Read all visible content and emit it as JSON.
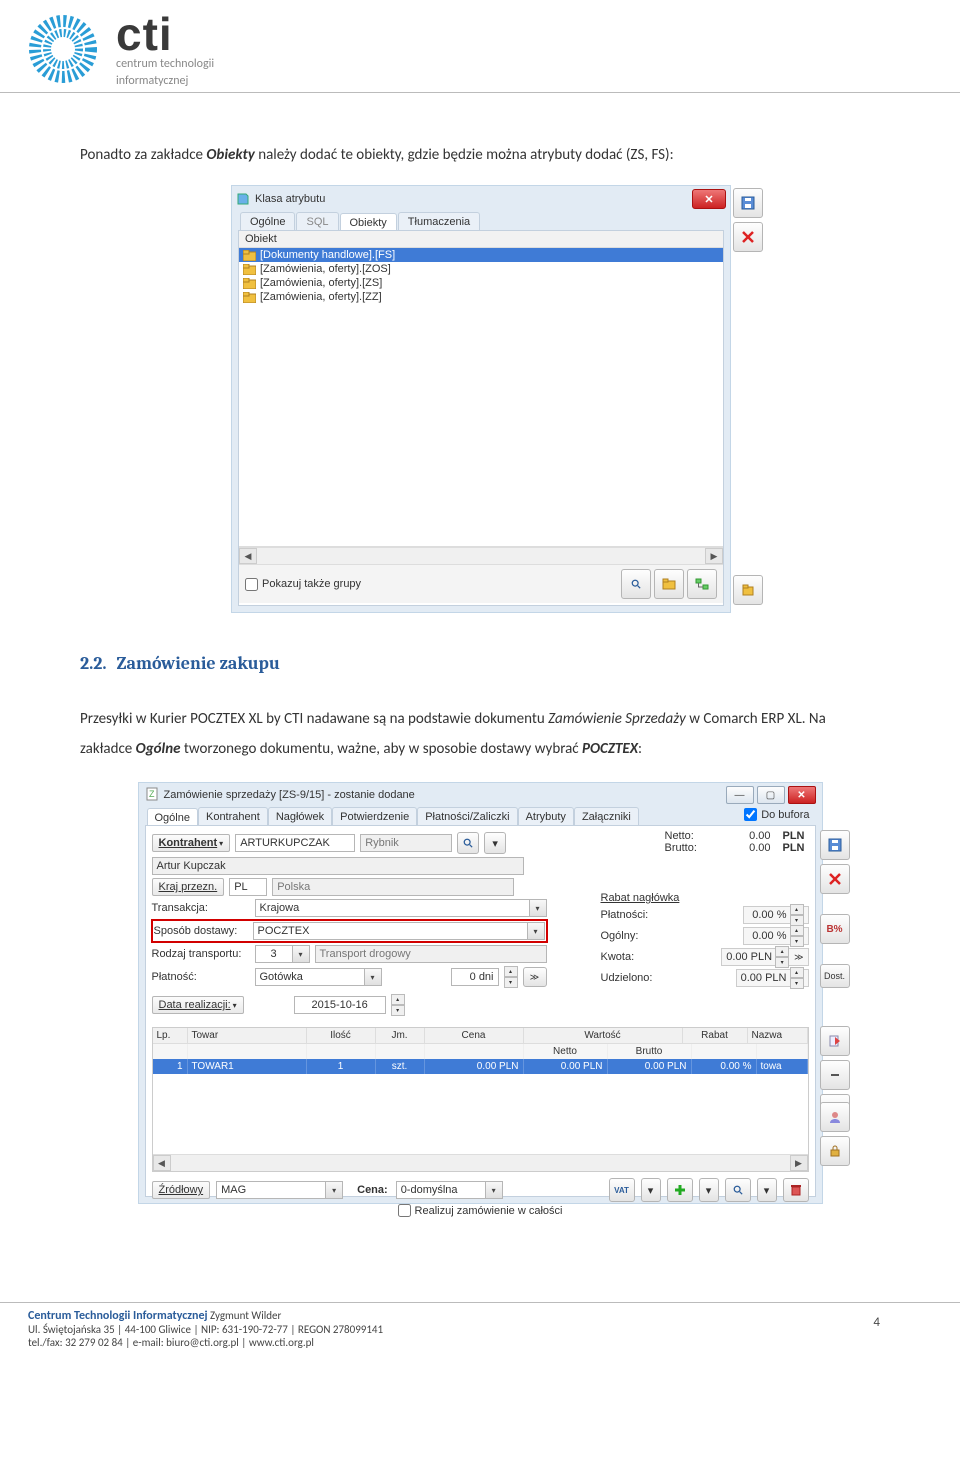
{
  "header": {
    "brand": "cti",
    "sub1": "centrum technologii",
    "sub2": "informatycznej"
  },
  "para1": {
    "pre": "Ponadto za zakładce ",
    "obj": "Obiekty",
    "post": " należy dodać te obiekty, gdzie będzie można atrybuty dodać (ZS, FS):"
  },
  "dlg1": {
    "title": "Klasa atrybutu",
    "tabs": [
      "Ogólne",
      "SQL",
      "Obiekty",
      "Tłumaczenia"
    ],
    "listhead": "Obiekt",
    "rows": [
      "[Dokumenty handlowe].[FS]",
      "[Zamówienia, oferty].[ZOS]",
      "[Zamówienia, oferty].[ZS]",
      "[Zamówienia, oferty].[ZZ]"
    ],
    "footer_chk": "Pokazuj także grupy"
  },
  "section": {
    "num": "2.2.",
    "title": "Zamówienie zakupu"
  },
  "para2": {
    "t": "Przesyłki w Kurier POCZTEX XL by CTI nadawane są na podstawie dokumentu ",
    "i1": "Zamówienie Sprzedaży",
    "t2": " w Comarch ERP XL. Na zakładce ",
    "bi": "Ogólne",
    "t3": " tworzonego dokumentu, ważne, aby w sposobie dostawy wybrać ",
    "bi2": "POCZTEX",
    "t4": ":"
  },
  "dlg2": {
    "title": "Zamówienie sprzedaży [ZS-9/15] - zostanie dodane",
    "tabs": [
      "Ogólne",
      "Kontrahent",
      "Nagłówek",
      "Potwierdzenie",
      "Płatności/Zaliczki",
      "Atrybuty",
      "Załączniki"
    ],
    "dobuf": "Do bufora",
    "kontrahent_btn": "Kontrahent",
    "kontrahent_val": "ARTURKUPCZAK",
    "city": "Rybnik",
    "name": "Artur Kupczak",
    "kraj_btn": "Kraj przezn.",
    "kraj_code": "PL",
    "kraj_name": "Polska",
    "transakcja_lbl": "Transakcja:",
    "transakcja_val": "Krajowa",
    "sposob_lbl": "Sposób dostawy:",
    "sposob_val": "POCZTEX",
    "rodzaj_lbl": "Rodzaj transportu:",
    "rodzaj_num": "3",
    "rodzaj_val": "Transport drogowy",
    "platnosc_lbl": "Płatność:",
    "platnosc_val": "Gotówka",
    "dni": "0 dni",
    "data_btn": "Data realizacji:",
    "data_val": "2015-10-16",
    "netto_lbl": "Netto:",
    "netto_val": "0.00",
    "brutto_lbl": "Brutto:",
    "brutto_val": "0.00",
    "pln": "PLN",
    "rabat_h": "Rabat nagłówka",
    "plat_lbl": "Płatności:",
    "plat_val": "0.00 %",
    "ogolny_lbl": "Ogólny:",
    "ogolny_val": "0.00 %",
    "kwota_lbl": "Kwota:",
    "kwota_val": "0.00 PLN",
    "udz_lbl": "Udzielono:",
    "udz_val": "0.00 PLN",
    "grid_head": {
      "lp": "Lp.",
      "towar": "Towar",
      "ilosc": "Ilość",
      "jm": "Jm.",
      "cena": "Cena",
      "wartosc": "Wartość",
      "netto": "Netto",
      "brutto": "Brutto",
      "rabat": "Rabat",
      "nazwa": "Nazwa"
    },
    "grid_row": {
      "lp": "1",
      "towar": "TOWAR1",
      "ilosc": "1",
      "jm": "szt.",
      "cena": "0.00   PLN",
      "netto": "0.00 PLN",
      "brutto": "0.00 PLN",
      "rabat": "0.00 %",
      "nazwa": "towa"
    },
    "zrodlowy_lbl": "Źródłowy",
    "zrodlowy_val": "MAG",
    "cena_lbl": "Cena:",
    "cena_val": "0-domyślna",
    "realizuj_chk": "Realizuj zamówienie w całości",
    "dost_btn": "Dost."
  },
  "footer": {
    "title_pre": "Centrum Technologii Informatycznej",
    "title_post": " Zygmunt Wilder",
    "l1": "Ul. Świętojańska 35  |  44-100 Gliwice  |  NIP: 631-190-72-77  |  REGON 278099141",
    "l2": "tel./fax: 32 279 02 84  |  e-mail: biuro@cti.org.pl  |  www.cti.org.pl",
    "page": "4"
  }
}
